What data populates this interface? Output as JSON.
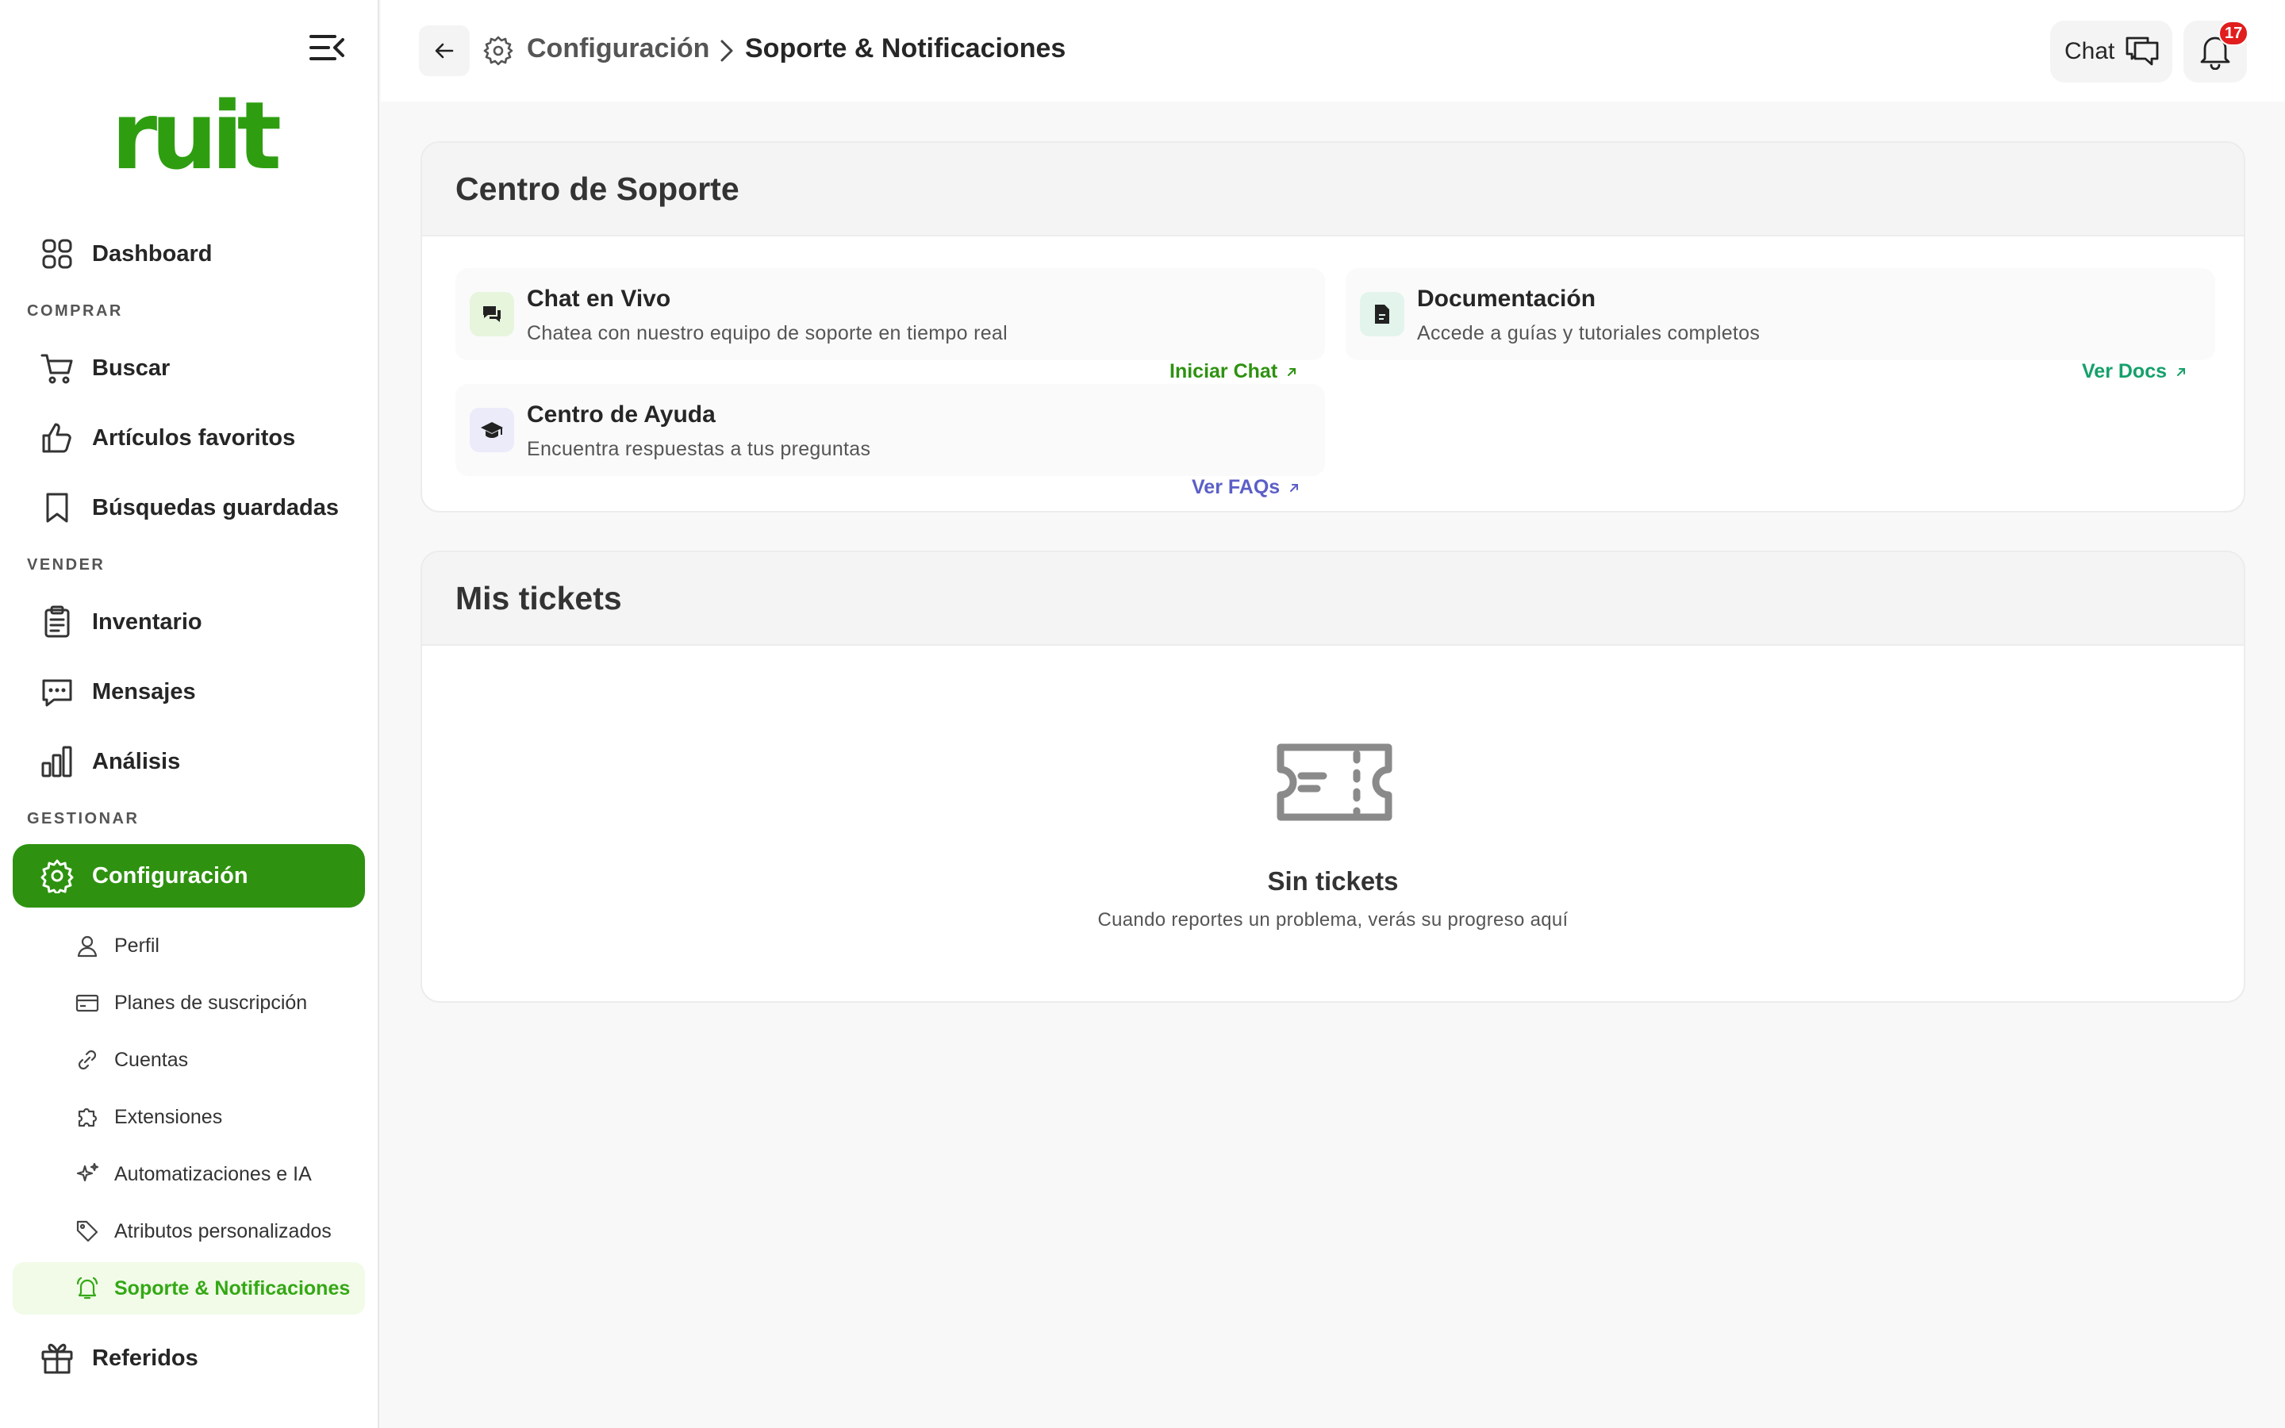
{
  "brand": {
    "logo_text": "ruit",
    "accent": "#2e9210"
  },
  "sidebar": {
    "dashboard": "Dashboard",
    "section_buy": "COMPRAR",
    "search": "Buscar",
    "favorites": "Artículos favoritos",
    "saved_searches": "Búsquedas guardadas",
    "section_sell": "VENDER",
    "inventory": "Inventario",
    "messages": "Mensajes",
    "analytics": "Análisis",
    "section_manage": "GESTIONAR",
    "settings": "Configuración",
    "sub": {
      "profile": "Perfil",
      "plans": "Planes de suscripción",
      "accounts": "Cuentas",
      "extensions": "Extensiones",
      "automations": "Automatizaciones e IA",
      "attributes": "Atributos personalizados",
      "support": "Soporte & Notificaciones"
    },
    "referrals": "Referidos"
  },
  "topbar": {
    "breadcrumb_parent": "Configuración",
    "breadcrumb_current": "Soporte & Notificaciones",
    "chat_label": "Chat",
    "notification_count": "17"
  },
  "support_center": {
    "title": "Centro de Soporte",
    "live_chat": {
      "title": "Chat en Vivo",
      "desc": "Chatea con nuestro equipo de soporte en tiempo real",
      "link": "Iniciar Chat",
      "color": "#2e9210"
    },
    "docs": {
      "title": "Documentación",
      "desc": "Accede a guías y tutoriales completos",
      "link": "Ver Docs",
      "color": "#15a06b"
    },
    "help": {
      "title": "Centro de Ayuda",
      "desc": "Encuentra respuestas a tus preguntas",
      "link": "Ver FAQs",
      "color": "#5b5fc7"
    }
  },
  "tickets": {
    "title": "Mis tickets",
    "empty_title": "Sin tickets",
    "empty_desc": "Cuando reportes un problema, verás su progreso aquí"
  }
}
